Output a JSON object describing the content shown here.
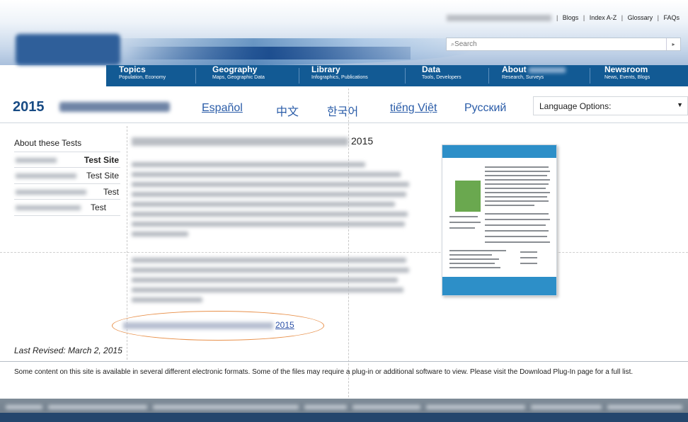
{
  "header": {
    "top_links": [
      "Blogs",
      "Index A-Z",
      "Glossary",
      "FAQs"
    ],
    "search_placeholder": "Search",
    "nav": [
      {
        "title": "Topics",
        "subtitle": "Population, Economy"
      },
      {
        "title": "Geography",
        "subtitle": "Maps, Geographic Data"
      },
      {
        "title": "Library",
        "subtitle": "Infographics, Publications"
      },
      {
        "title": "Data",
        "subtitle": "Tools, Developers"
      },
      {
        "title": "About",
        "subtitle": "Research, Surveys"
      },
      {
        "title": "Newsroom",
        "subtitle": "News, Events, Blogs"
      }
    ]
  },
  "lang_bar": {
    "year": "2015",
    "languages": [
      "Español",
      "中文",
      "한국어",
      "tiếng Việt",
      "Русский"
    ],
    "select_label": "Language Options:"
  },
  "sidebar": {
    "first": "About these Tests",
    "items": [
      "Test Site",
      "Test Site",
      "Test",
      "Test"
    ]
  },
  "main": {
    "title_year": "2015",
    "link_year": "2015"
  },
  "footer": {
    "revised": "Last Revised: March 2, 2015",
    "note": "Some content on this site is available in several different electronic formats. Some of the files may require a plug-in or additional software to view. Please visit the Download Plug-In page for a full list."
  },
  "colors": {
    "nav_blue": "#125a94",
    "link_blue": "#2a5ca8",
    "highlight_oval": "#e8904a",
    "doc_accent": "#2d8fc8"
  }
}
